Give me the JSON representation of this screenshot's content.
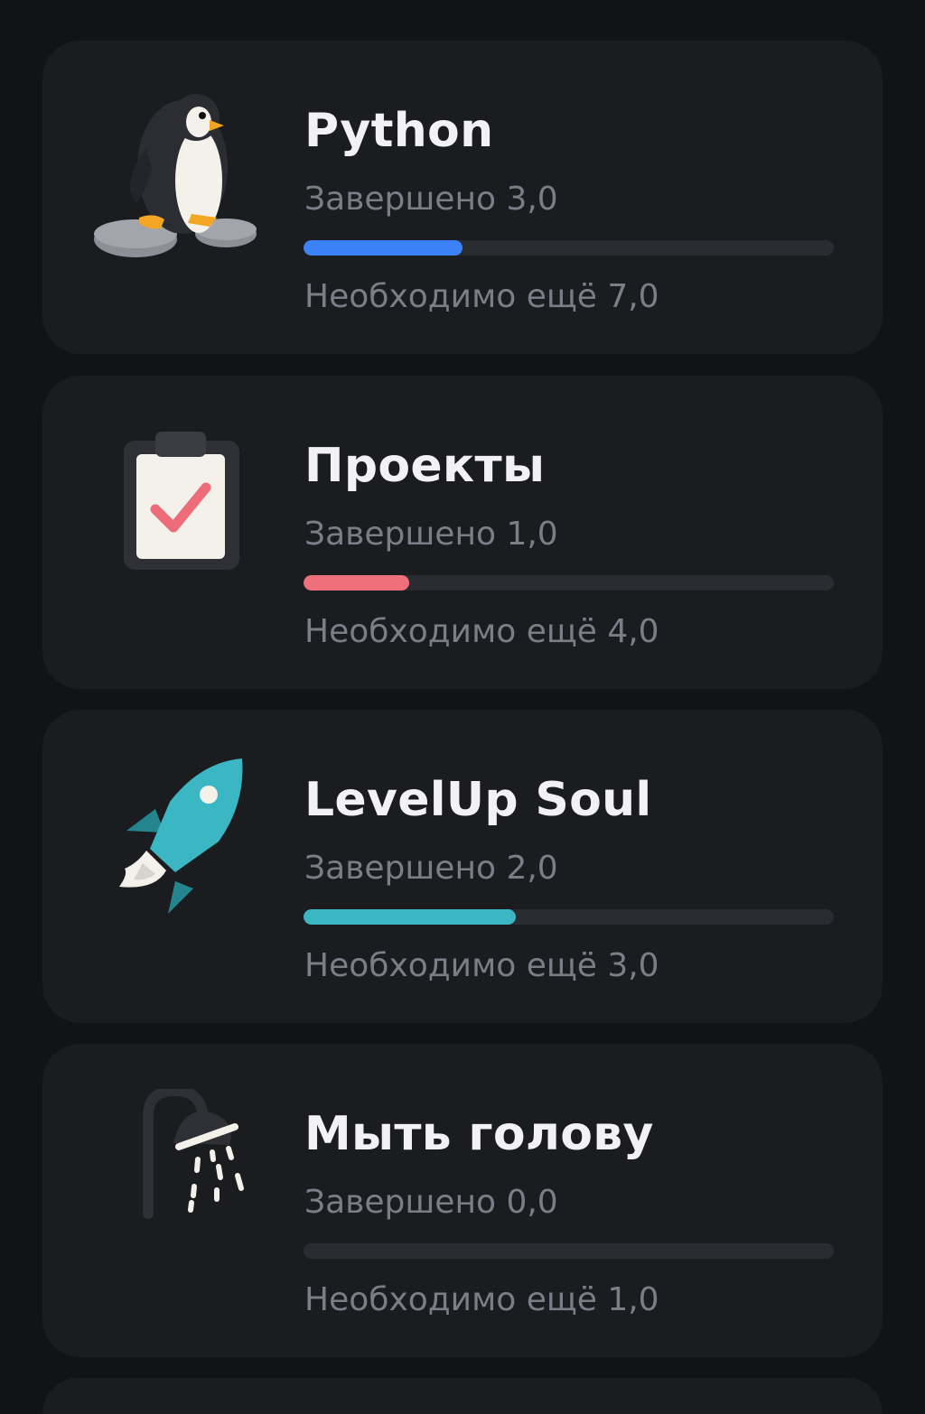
{
  "goals": [
    {
      "title": "Python",
      "icon": "penguin-icon",
      "completed_label": "Завершено 3,0",
      "remaining_label": "Необходимо ещё 7,0",
      "progress": 0.3,
      "color": "#3b82f6"
    },
    {
      "title": "Проекты",
      "icon": "clipboard-check-icon",
      "completed_label": "Завершено 1,0",
      "remaining_label": "Необходимо ещё 4,0",
      "progress": 0.2,
      "color": "#ef6f7a"
    },
    {
      "title": "LevelUp Soul",
      "icon": "rocket-icon",
      "completed_label": "Завершено 2,0",
      "remaining_label": "Необходимо ещё 3,0",
      "progress": 0.4,
      "color": "#3bb7c4"
    },
    {
      "title": "Мыть голову",
      "icon": "shower-icon",
      "completed_label": "Завершено 0,0",
      "remaining_label": "Необходимо ещё 1,0",
      "progress": 0.0,
      "color": "#3bb7c4"
    }
  ]
}
